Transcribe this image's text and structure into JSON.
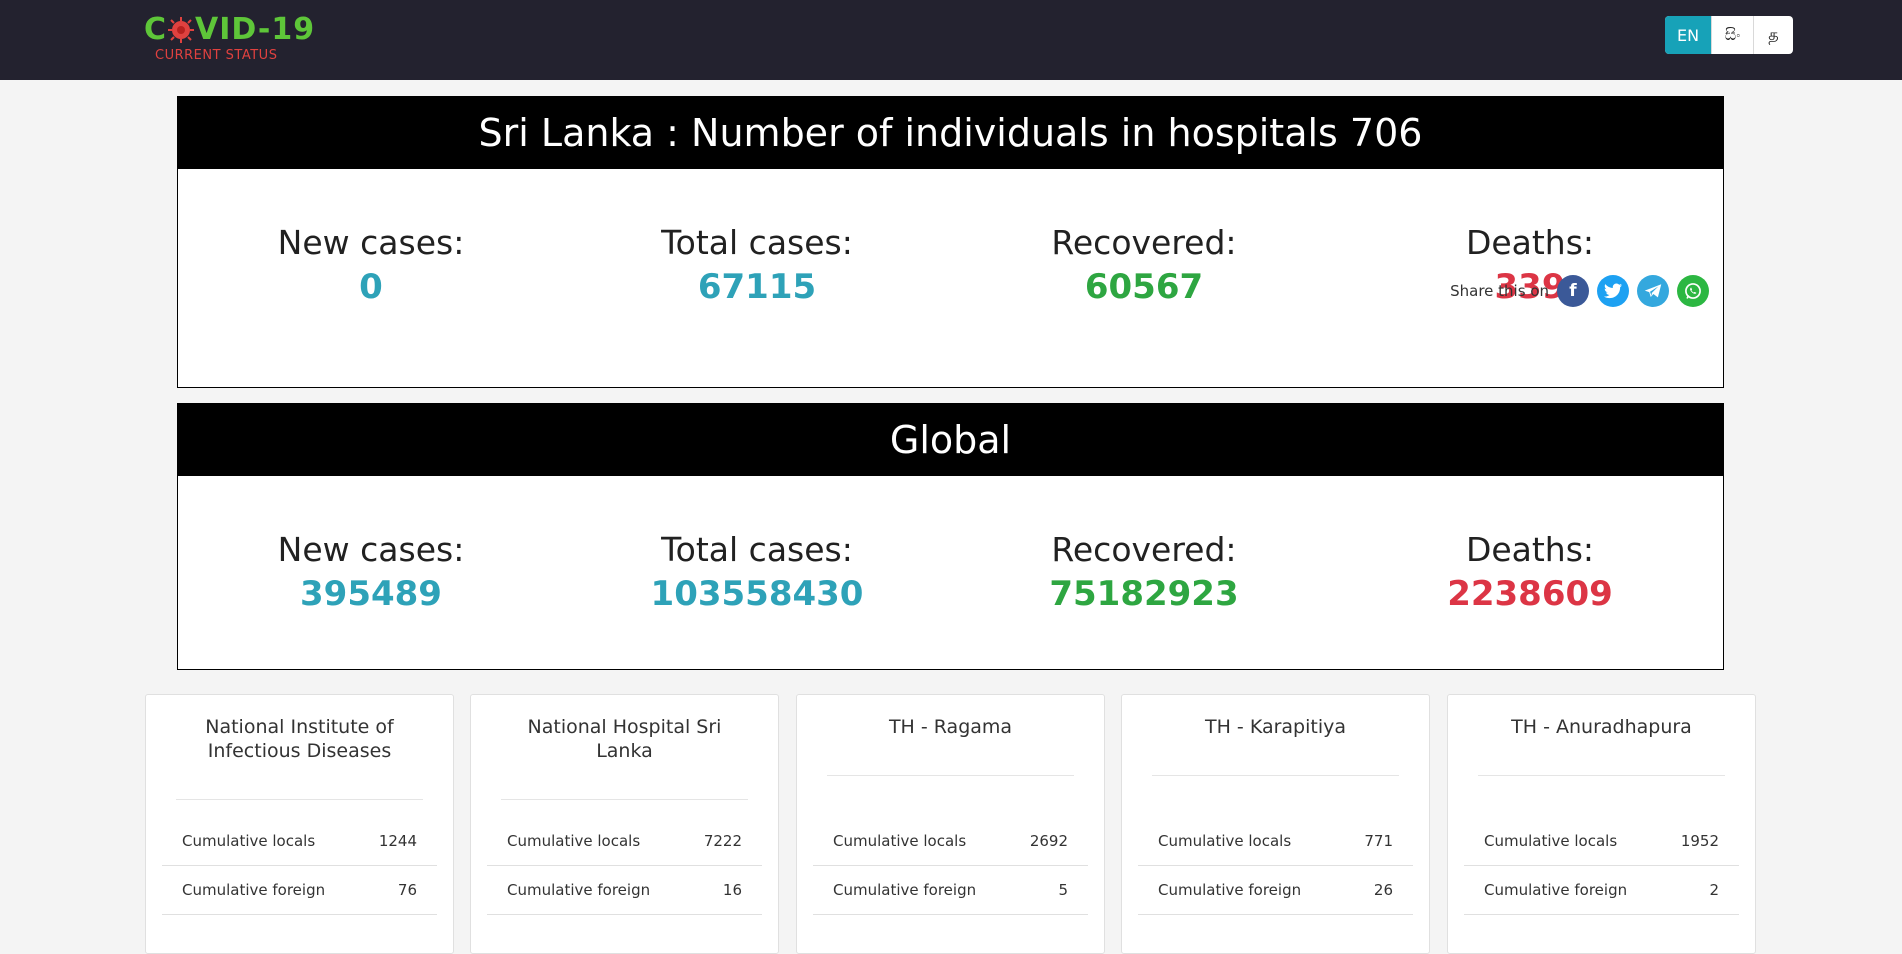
{
  "header": {
    "logo_title_part1": "C",
    "logo_title_part2": "VID-19",
    "logo_subtitle": "CURRENT STATUS",
    "logo_icon": "virus-icon",
    "languages": [
      {
        "label": "EN",
        "active": true
      },
      {
        "label": "සිං",
        "active": false
      },
      {
        "label": "த",
        "active": false
      }
    ]
  },
  "sri_lanka": {
    "title": "Sri Lanka : Number of individuals in hospitals 706",
    "stats": [
      {
        "label": "New cases:",
        "value": "0"
      },
      {
        "label": "Total cases:",
        "value": "67115"
      },
      {
        "label": "Recovered:",
        "value": "60567"
      },
      {
        "label": "Deaths:",
        "value": "339"
      }
    ],
    "share": {
      "label": "Share this on",
      "icons": [
        "facebook-icon",
        "twitter-icon",
        "telegram-icon",
        "whatsapp-icon"
      ]
    }
  },
  "global": {
    "title": "Global",
    "stats": [
      {
        "label": "New cases:",
        "value": "395489"
      },
      {
        "label": "Total cases:",
        "value": "103558430"
      },
      {
        "label": "Recovered:",
        "value": "75182923"
      },
      {
        "label": "Deaths:",
        "value": "2238609"
      }
    ]
  },
  "hospitals": [
    {
      "name": "National Institute of Infectious Diseases",
      "rows": [
        {
          "label": "Cumulative locals",
          "value": "1244"
        },
        {
          "label": "Cumulative foreign",
          "value": "76"
        }
      ]
    },
    {
      "name": "National Hospital Sri Lanka",
      "rows": [
        {
          "label": "Cumulative locals",
          "value": "7222"
        },
        {
          "label": "Cumulative foreign",
          "value": "16"
        }
      ]
    },
    {
      "name": "TH - Ragama",
      "rows": [
        {
          "label": "Cumulative locals",
          "value": "2692"
        },
        {
          "label": "Cumulative foreign",
          "value": "5"
        }
      ]
    },
    {
      "name": "TH - Karapitiya",
      "rows": [
        {
          "label": "Cumulative locals",
          "value": "771"
        },
        {
          "label": "Cumulative foreign",
          "value": "26"
        }
      ]
    },
    {
      "name": "TH - Anuradhapura",
      "rows": [
        {
          "label": "Cumulative locals",
          "value": "1952"
        },
        {
          "label": "Cumulative foreign",
          "value": "2"
        }
      ]
    }
  ],
  "colors": {
    "header_bg": "#23222f",
    "accent": "#17a2b8",
    "recovered": "#2ea641",
    "deaths": "#dc3545",
    "logo_green": "#5ec639",
    "logo_red": "#e0413f"
  }
}
